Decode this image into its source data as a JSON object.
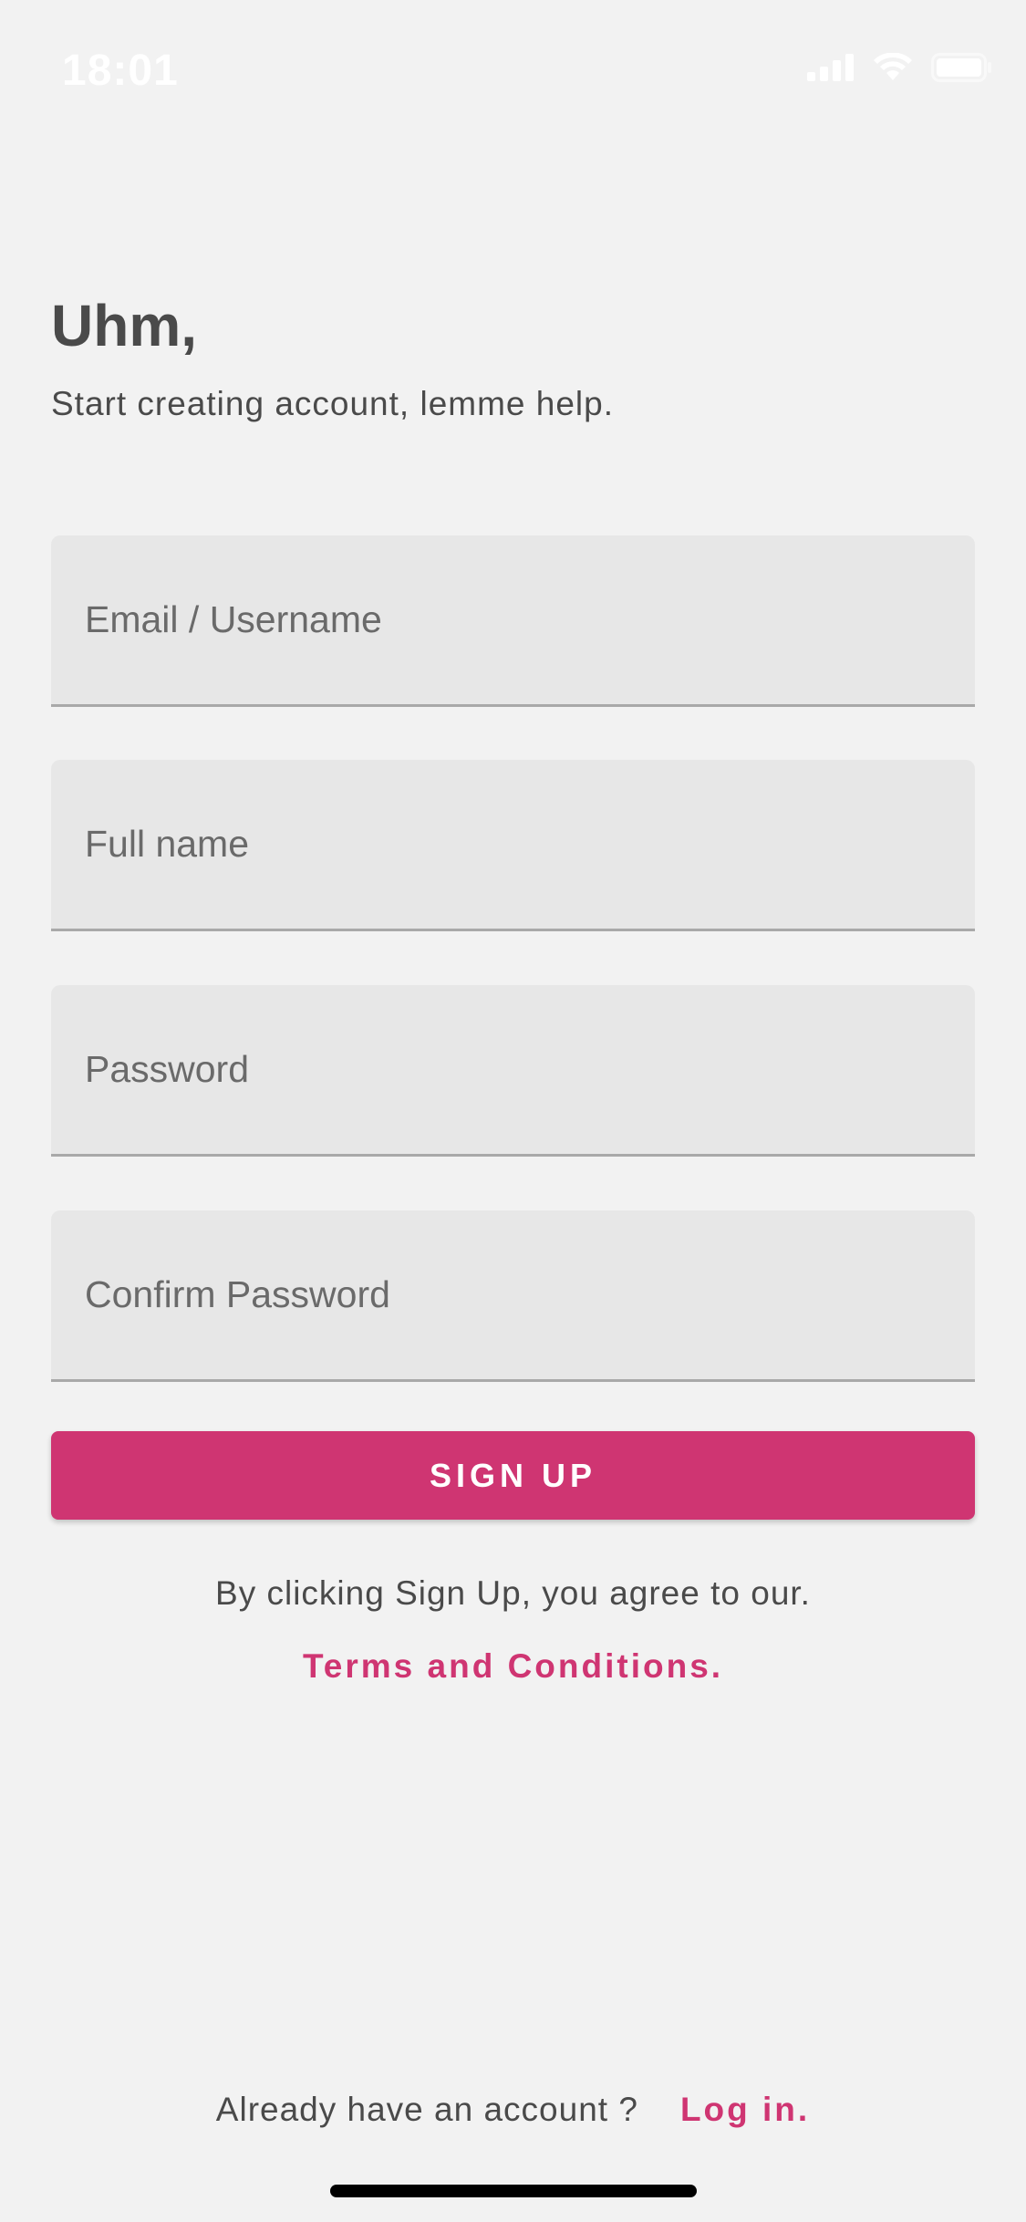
{
  "status_bar": {
    "time": "18:01",
    "icons": [
      "cellular-signal-icon",
      "wifi-icon",
      "battery-icon"
    ]
  },
  "header": {
    "title": "Uhm,",
    "subtitle": "Start creating account, lemme help."
  },
  "form": {
    "email_placeholder": "Email / Username",
    "email_value": "",
    "fullname_placeholder": "Full name",
    "fullname_value": "",
    "password_placeholder": "Password",
    "password_value": "",
    "confirm_placeholder": "Confirm Password",
    "confirm_value": "",
    "signup_label": "SIGN UP"
  },
  "agreement": {
    "text": "By clicking Sign Up, you agree to our.",
    "link": "Terms and Conditions."
  },
  "footer": {
    "prompt": "Already have an account ?",
    "login_link": "Log in."
  },
  "colors": {
    "accent": "#cf3572",
    "background": "#f2f2f2",
    "field_background": "#e7e7e7",
    "text": "#4a4a4a"
  }
}
